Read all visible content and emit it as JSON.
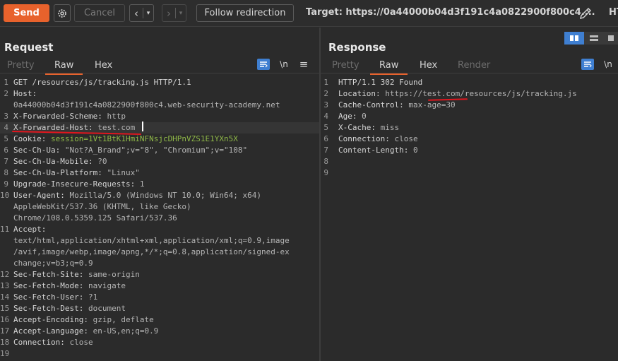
{
  "toolbar": {
    "send_label": "Send",
    "cancel_label": "Cancel",
    "back_icon": "chevron-left",
    "forward_icon": "chevron-right",
    "follow_label": "Follow redirection",
    "target_label": "Target: https://0a44000b04d3f191c4a0822900f800c4....",
    "ht_label": "HT"
  },
  "request": {
    "title": "Request",
    "tabs": [
      "Pretty",
      "Raw",
      "Hex"
    ],
    "active_tab": "Raw",
    "tools": [
      "format-icon",
      "newline-icon",
      "menu-icon"
    ],
    "tool_glyphs": {
      "newline": "\\n",
      "menu": "≡"
    },
    "lines": [
      {
        "n": "1",
        "name": "GET /resources/js/tracking.js HTTP/1.1",
        "value": ""
      },
      {
        "n": "2",
        "name": "Host",
        "sep": ":",
        "value": ""
      },
      {
        "n": "",
        "name": "",
        "value": "0a44000b04d3f191c4a0822900f800c4.web-security-academy.net"
      },
      {
        "n": "3",
        "name": "X-Forwarded-Scheme",
        "sep": ": ",
        "value": "http"
      },
      {
        "n": "4",
        "name": "X-Forwarded-Host",
        "sep": ": ",
        "value": "test.com"
      },
      {
        "n": "5",
        "name": "Cookie",
        "sep": ": ",
        "value": "session=1Vt1BtK1HmiNFNsjcDHPnVZS1E1YXn5X"
      },
      {
        "n": "6",
        "name": "Sec-Ch-Ua",
        "sep": ": ",
        "value": "\"Not?A_Brand\";v=\"8\", \"Chromium\";v=\"108\""
      },
      {
        "n": "7",
        "name": "Sec-Ch-Ua-Mobile",
        "sep": ": ",
        "value": "?0"
      },
      {
        "n": "8",
        "name": "Sec-Ch-Ua-Platform",
        "sep": ": ",
        "value": "\"Linux\""
      },
      {
        "n": "9",
        "name": "Upgrade-Insecure-Requests",
        "sep": ": ",
        "value": "1"
      },
      {
        "n": "10",
        "name": "User-Agent",
        "sep": ": ",
        "value": "Mozilla/5.0 (Windows NT 10.0; Win64; x64)"
      },
      {
        "n": "",
        "name": "",
        "value": "AppleWebKit/537.36 (KHTML, like Gecko)"
      },
      {
        "n": "",
        "name": "",
        "value": "Chrome/108.0.5359.125 Safari/537.36"
      },
      {
        "n": "11",
        "name": "Accept",
        "sep": ":",
        "value": ""
      },
      {
        "n": "",
        "name": "",
        "value": "text/html,application/xhtml+xml,application/xml;q=0.9,image"
      },
      {
        "n": "",
        "name": "",
        "value": "/avif,image/webp,image/apng,*/*;q=0.8,application/signed-ex"
      },
      {
        "n": "",
        "name": "",
        "value": "change;v=b3;q=0.9"
      },
      {
        "n": "12",
        "name": "Sec-Fetch-Site",
        "sep": ": ",
        "value": "same-origin"
      },
      {
        "n": "13",
        "name": "Sec-Fetch-Mode",
        "sep": ": ",
        "value": "navigate"
      },
      {
        "n": "14",
        "name": "Sec-Fetch-User",
        "sep": ": ",
        "value": "?1"
      },
      {
        "n": "15",
        "name": "Sec-Fetch-Dest",
        "sep": ": ",
        "value": "document"
      },
      {
        "n": "16",
        "name": "Accept-Encoding",
        "sep": ": ",
        "value": "gzip, deflate"
      },
      {
        "n": "17",
        "name": "Accept-Language",
        "sep": ": ",
        "value": "en-US,en;q=0.9"
      },
      {
        "n": "18",
        "name": "Connection",
        "sep": ": ",
        "value": "close"
      },
      {
        "n": "19",
        "name": "",
        "value": ""
      }
    ]
  },
  "response": {
    "title": "Response",
    "tabs": [
      "Pretty",
      "Raw",
      "Hex",
      "Render"
    ],
    "active_tab": "Raw",
    "tools": [
      "format-icon",
      "newline-icon"
    ],
    "tool_glyphs": {
      "newline": "\\n"
    },
    "lines": [
      {
        "n": "1",
        "name": "HTTP/1.1 302 Found",
        "value": ""
      },
      {
        "n": "2",
        "name": "Location",
        "sep": ": ",
        "value": "https://test.com/resources/js/tracking.js"
      },
      {
        "n": "3",
        "name": "Cache-Control",
        "sep": ": ",
        "value": "max-age=30"
      },
      {
        "n": "4",
        "name": "Age",
        "sep": ": ",
        "value": "0"
      },
      {
        "n": "5",
        "name": "X-Cache",
        "sep": ": ",
        "value": "miss"
      },
      {
        "n": "6",
        "name": "Connection",
        "sep": ": ",
        "value": "close"
      },
      {
        "n": "7",
        "name": "Content-Length",
        "sep": ": ",
        "value": "0"
      },
      {
        "n": "8",
        "name": "",
        "value": ""
      },
      {
        "n": "9",
        "name": "",
        "value": ""
      }
    ]
  },
  "colors": {
    "accent": "#e8622c",
    "blue": "#3f7fd1",
    "annotation_red": "#e0161e",
    "cookie_green": "#8fb848"
  }
}
